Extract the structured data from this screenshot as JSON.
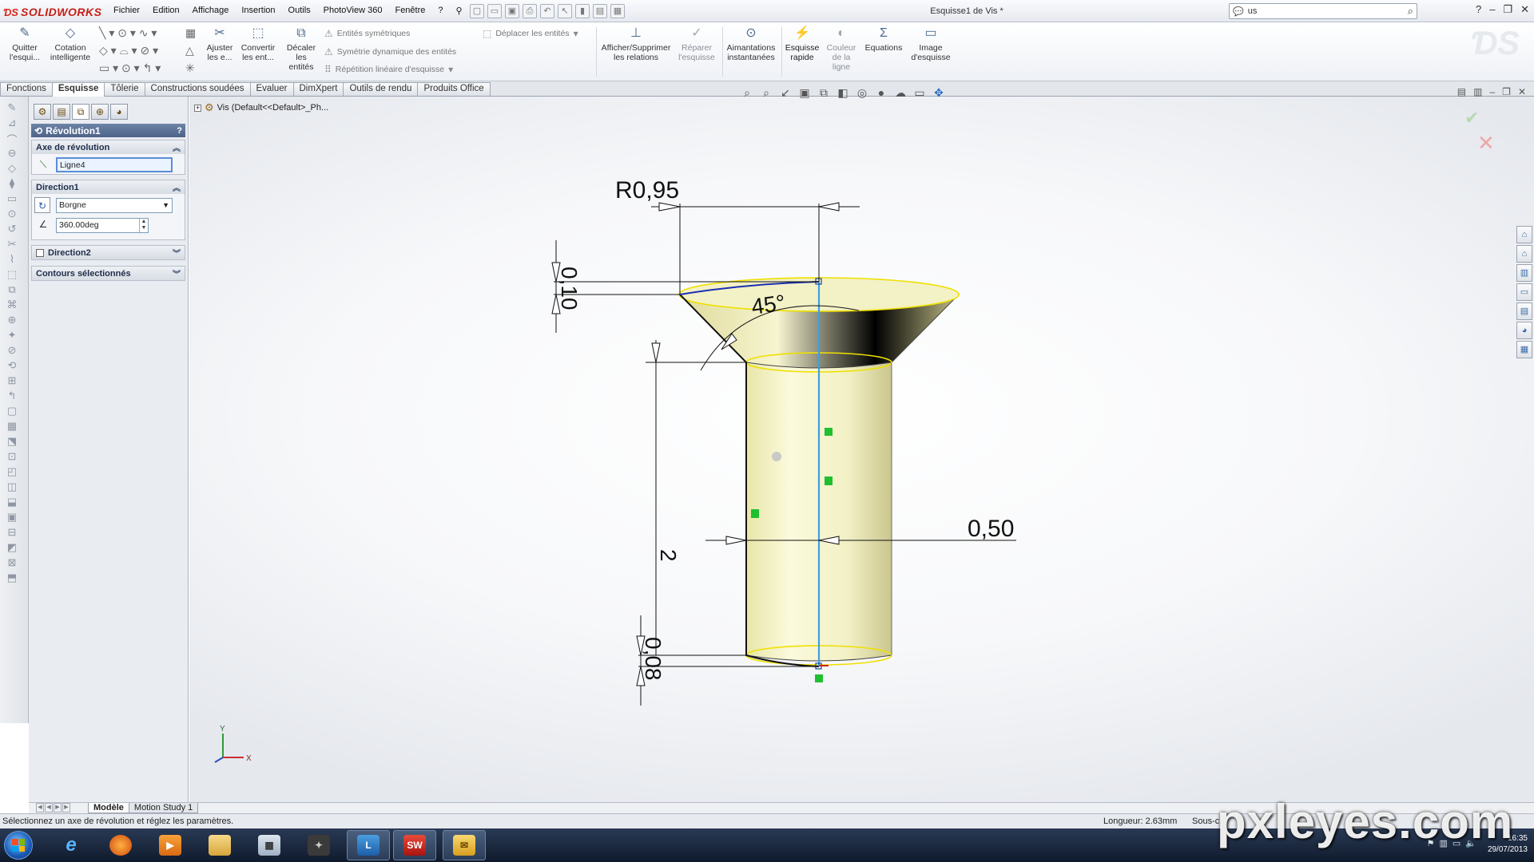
{
  "app": {
    "brand": "SOLIDWORKS",
    "document_title": "Esquisse1 de Vis *",
    "menu": [
      "Fichier",
      "Edition",
      "Affichage",
      "Insertion",
      "Outils",
      "PhotoView 360",
      "Fenêtre",
      "?"
    ],
    "search_value": "us"
  },
  "commands": {
    "quit_sketch": "Quitter l'esqui...",
    "smart_dim": "Cotation intelligente",
    "trim": "Ajuster les e...",
    "convert": "Convertir les ent...",
    "offset": "Décaler les entités",
    "mirror": "Entités symétriques",
    "dyn_mirror": "Symétrie dynamique des entités",
    "lin_pattern": "Répétition linéaire d'esquisse",
    "move": "Déplacer les entités",
    "relations": "Afficher/Supprimer les relations",
    "repair": "Réparer l'esquisse",
    "snaps": "Aimantations instantanées",
    "rapid": "Esquisse rapide",
    "color": "Couleur de la ligne",
    "equations": "Equations",
    "image": "Image d'esquisse"
  },
  "tabs": [
    "Fonctions",
    "Esquisse",
    "Tôlerie",
    "Constructions soudées",
    "Evaluer",
    "DimXpert",
    "Outils de rendu",
    "Produits Office"
  ],
  "active_tab": "Esquisse",
  "property_manager": {
    "title": "Révolution1",
    "help": "?",
    "axis_group": "Axe de révolution",
    "axis_value": "Ligne4",
    "dir1_group": "Direction1",
    "dir1_type": "Borgne",
    "dir1_angle": "360.00deg",
    "dir2_group": "Direction2",
    "contours_group": "Contours sélectionnés"
  },
  "tree": {
    "root_label": "Vis (Default<<Default>_Ph..."
  },
  "dimensions": {
    "radius": "R0,95",
    "top_height": "0,10",
    "angle": "45°",
    "length": "2",
    "diameter": "0,50",
    "bottom_height": "0,08"
  },
  "triad": {
    "y": "Y",
    "x": "X"
  },
  "model_tabs": [
    "Modèle",
    "Motion Study 1"
  ],
  "status": {
    "message": "Sélectionnez un axe de révolution et réglez les paramètres.",
    "length": "Longueur: 2.63mm",
    "state": "Sous-c"
  },
  "taskbar": {
    "apps": [
      "ie",
      "firefox",
      "media",
      "explorer",
      "calculator",
      "game",
      "lync",
      "solidworks",
      "outlook"
    ],
    "time": "16:35",
    "date": "29/07/2013"
  },
  "watermark": "pxleyes.com",
  "colors": {
    "brand_red": "#d8261c",
    "pm_header": "#4d6388",
    "axis_blue": "#3e9fe0",
    "body_fill": "#f3f1c6",
    "edge_yellow": "#f0e000",
    "relation_green": "#1fbf2f"
  }
}
